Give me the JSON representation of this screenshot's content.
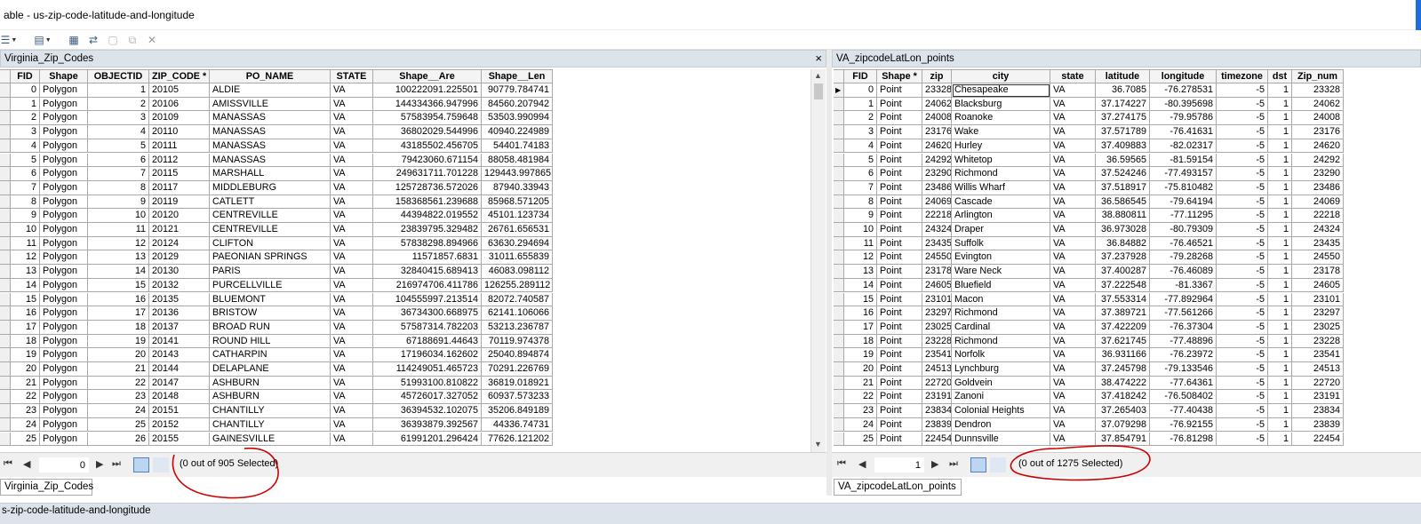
{
  "window": {
    "title": "able - us-zip-code-latitude-and-longitude"
  },
  "toolbar": {
    "items": [
      "table-options-icon",
      "related-tables-icon",
      "select-by-attributes-icon",
      "switch-selection-icon",
      "clear-selection-icon",
      "zoom-to-selected-icon",
      "delete-selected-icon"
    ]
  },
  "left": {
    "title": "Virginia_Zip_Codes",
    "close": "×",
    "columns": [
      "FID",
      "Shape",
      "OBJECTID",
      "ZIP_CODE *",
      "PO_NAME",
      "STATE",
      "Shape__Are",
      "Shape__Len"
    ],
    "rows": [
      [
        "0",
        "Polygon",
        "1",
        "20105",
        "ALDIE",
        "VA",
        "100222091.225501",
        "90779.784741"
      ],
      [
        "1",
        "Polygon",
        "2",
        "20106",
        "AMISSVILLE",
        "VA",
        "144334366.947996",
        "84560.207942"
      ],
      [
        "2",
        "Polygon",
        "3",
        "20109",
        "MANASSAS",
        "VA",
        "57583954.759648",
        "53503.990994"
      ],
      [
        "3",
        "Polygon",
        "4",
        "20110",
        "MANASSAS",
        "VA",
        "36802029.544996",
        "40940.224989"
      ],
      [
        "4",
        "Polygon",
        "5",
        "20111",
        "MANASSAS",
        "VA",
        "43185502.456705",
        "54401.74183"
      ],
      [
        "5",
        "Polygon",
        "6",
        "20112",
        "MANASSAS",
        "VA",
        "79423060.671154",
        "88058.481984"
      ],
      [
        "6",
        "Polygon",
        "7",
        "20115",
        "MARSHALL",
        "VA",
        "249631711.701228",
        "129443.997865"
      ],
      [
        "7",
        "Polygon",
        "8",
        "20117",
        "MIDDLEBURG",
        "VA",
        "125728736.572026",
        "87940.33943"
      ],
      [
        "8",
        "Polygon",
        "9",
        "20119",
        "CATLETT",
        "VA",
        "158368561.239688",
        "85968.571205"
      ],
      [
        "9",
        "Polygon",
        "10",
        "20120",
        "CENTREVILLE",
        "VA",
        "44394822.019552",
        "45101.123734"
      ],
      [
        "10",
        "Polygon",
        "11",
        "20121",
        "CENTREVILLE",
        "VA",
        "23839795.329482",
        "26761.656531"
      ],
      [
        "11",
        "Polygon",
        "12",
        "20124",
        "CLIFTON",
        "VA",
        "57838298.894966",
        "63630.294694"
      ],
      [
        "12",
        "Polygon",
        "13",
        "20129",
        "PAEONIAN SPRINGS",
        "VA",
        "11571857.6831",
        "31011.655839"
      ],
      [
        "13",
        "Polygon",
        "14",
        "20130",
        "PARIS",
        "VA",
        "32840415.689413",
        "46083.098112"
      ],
      [
        "14",
        "Polygon",
        "15",
        "20132",
        "PURCELLVILLE",
        "VA",
        "216974706.411786",
        "126255.289112"
      ],
      [
        "15",
        "Polygon",
        "16",
        "20135",
        "BLUEMONT",
        "VA",
        "104555997.213514",
        "82072.740587"
      ],
      [
        "16",
        "Polygon",
        "17",
        "20136",
        "BRISTOW",
        "VA",
        "36734300.668975",
        "62141.106066"
      ],
      [
        "17",
        "Polygon",
        "18",
        "20137",
        "BROAD RUN",
        "VA",
        "57587314.782203",
        "53213.236787"
      ],
      [
        "18",
        "Polygon",
        "19",
        "20141",
        "ROUND HILL",
        "VA",
        "67188691.44643",
        "70119.974378"
      ],
      [
        "19",
        "Polygon",
        "20",
        "20143",
        "CATHARPIN",
        "VA",
        "17196034.162602",
        "25040.894874"
      ],
      [
        "20",
        "Polygon",
        "21",
        "20144",
        "DELAPLANE",
        "VA",
        "114249051.465723",
        "70291.226769"
      ],
      [
        "21",
        "Polygon",
        "22",
        "20147",
        "ASHBURN",
        "VA",
        "51993100.810822",
        "36819.018921"
      ],
      [
        "22",
        "Polygon",
        "23",
        "20148",
        "ASHBURN",
        "VA",
        "45726017.327052",
        "60937.573233"
      ],
      [
        "23",
        "Polygon",
        "24",
        "20151",
        "CHANTILLY",
        "VA",
        "36394532.102075",
        "35206.849189"
      ],
      [
        "24",
        "Polygon",
        "25",
        "20152",
        "CHANTILLY",
        "VA",
        "36393879.392567",
        "44336.74731"
      ],
      [
        "25",
        "Polygon",
        "26",
        "20155",
        "GAINESVILLE",
        "VA",
        "61991201.296424",
        "77626.121202"
      ]
    ],
    "record": "0",
    "selection": "(0 out of 905 Selected)",
    "tab": "Virginia_Zip_Codes"
  },
  "right": {
    "title": "VA_zipcodeLatLon_points",
    "columns": [
      "FID",
      "Shape *",
      "zip",
      "city",
      "state",
      "latitude",
      "longitude",
      "timezone",
      "dst",
      "Zip_num"
    ],
    "rows": [
      [
        "0",
        "Point",
        "23328",
        "Chesapeake",
        "VA",
        "36.7085",
        "-76.278531",
        "-5",
        "1",
        "23328"
      ],
      [
        "1",
        "Point",
        "24062",
        "Blacksburg",
        "VA",
        "37.174227",
        "-80.395698",
        "-5",
        "1",
        "24062"
      ],
      [
        "2",
        "Point",
        "24008",
        "Roanoke",
        "VA",
        "37.274175",
        "-79.95786",
        "-5",
        "1",
        "24008"
      ],
      [
        "3",
        "Point",
        "23176",
        "Wake",
        "VA",
        "37.571789",
        "-76.41631",
        "-5",
        "1",
        "23176"
      ],
      [
        "4",
        "Point",
        "24620",
        "Hurley",
        "VA",
        "37.409883",
        "-82.02317",
        "-5",
        "1",
        "24620"
      ],
      [
        "5",
        "Point",
        "24292",
        "Whitetop",
        "VA",
        "36.59565",
        "-81.59154",
        "-5",
        "1",
        "24292"
      ],
      [
        "6",
        "Point",
        "23290",
        "Richmond",
        "VA",
        "37.524246",
        "-77.493157",
        "-5",
        "1",
        "23290"
      ],
      [
        "7",
        "Point",
        "23486",
        "Willis Wharf",
        "VA",
        "37.518917",
        "-75.810482",
        "-5",
        "1",
        "23486"
      ],
      [
        "8",
        "Point",
        "24069",
        "Cascade",
        "VA",
        "36.586545",
        "-79.64194",
        "-5",
        "1",
        "24069"
      ],
      [
        "9",
        "Point",
        "22218",
        "Arlington",
        "VA",
        "38.880811",
        "-77.11295",
        "-5",
        "1",
        "22218"
      ],
      [
        "10",
        "Point",
        "24324",
        "Draper",
        "VA",
        "36.973028",
        "-80.79309",
        "-5",
        "1",
        "24324"
      ],
      [
        "11",
        "Point",
        "23435",
        "Suffolk",
        "VA",
        "36.84882",
        "-76.46521",
        "-5",
        "1",
        "23435"
      ],
      [
        "12",
        "Point",
        "24550",
        "Evington",
        "VA",
        "37.237928",
        "-79.28268",
        "-5",
        "1",
        "24550"
      ],
      [
        "13",
        "Point",
        "23178",
        "Ware Neck",
        "VA",
        "37.400287",
        "-76.46089",
        "-5",
        "1",
        "23178"
      ],
      [
        "14",
        "Point",
        "24605",
        "Bluefield",
        "VA",
        "37.222548",
        "-81.3367",
        "-5",
        "1",
        "24605"
      ],
      [
        "15",
        "Point",
        "23101",
        "Macon",
        "VA",
        "37.553314",
        "-77.892964",
        "-5",
        "1",
        "23101"
      ],
      [
        "16",
        "Point",
        "23297",
        "Richmond",
        "VA",
        "37.389721",
        "-77.561266",
        "-5",
        "1",
        "23297"
      ],
      [
        "17",
        "Point",
        "23025",
        "Cardinal",
        "VA",
        "37.422209",
        "-76.37304",
        "-5",
        "1",
        "23025"
      ],
      [
        "18",
        "Point",
        "23228",
        "Richmond",
        "VA",
        "37.621745",
        "-77.48896",
        "-5",
        "1",
        "23228"
      ],
      [
        "19",
        "Point",
        "23541",
        "Norfolk",
        "VA",
        "36.931166",
        "-76.23972",
        "-5",
        "1",
        "23541"
      ],
      [
        "20",
        "Point",
        "24513",
        "Lynchburg",
        "VA",
        "37.245798",
        "-79.133546",
        "-5",
        "1",
        "24513"
      ],
      [
        "21",
        "Point",
        "22720",
        "Goldvein",
        "VA",
        "38.474222",
        "-77.64361",
        "-5",
        "1",
        "22720"
      ],
      [
        "22",
        "Point",
        "23191",
        "Zanoni",
        "VA",
        "37.418242",
        "-76.508402",
        "-5",
        "1",
        "23191"
      ],
      [
        "23",
        "Point",
        "23834",
        "Colonial Heights",
        "VA",
        "37.265403",
        "-77.40438",
        "-5",
        "1",
        "23834"
      ],
      [
        "24",
        "Point",
        "23839",
        "Dendron",
        "VA",
        "37.079298",
        "-76.92155",
        "-5",
        "1",
        "23839"
      ],
      [
        "25",
        "Point",
        "22454",
        "Dunnsville",
        "VA",
        "37.854791",
        "-76.81298",
        "-5",
        "1",
        "22454"
      ]
    ],
    "record": "1",
    "selection": "(0 out of 1275 Selected)",
    "tab": "VA_zipcodeLatLon_points"
  },
  "nav": {
    "first": "⏮",
    "prev": "◀",
    "next": "▶",
    "last": "⏭"
  },
  "status": {
    "text": "s-zip-code-latitude-and-longitude"
  },
  "colors": {
    "annotation": "#cc0000",
    "header_bg": "#dde3ea"
  }
}
